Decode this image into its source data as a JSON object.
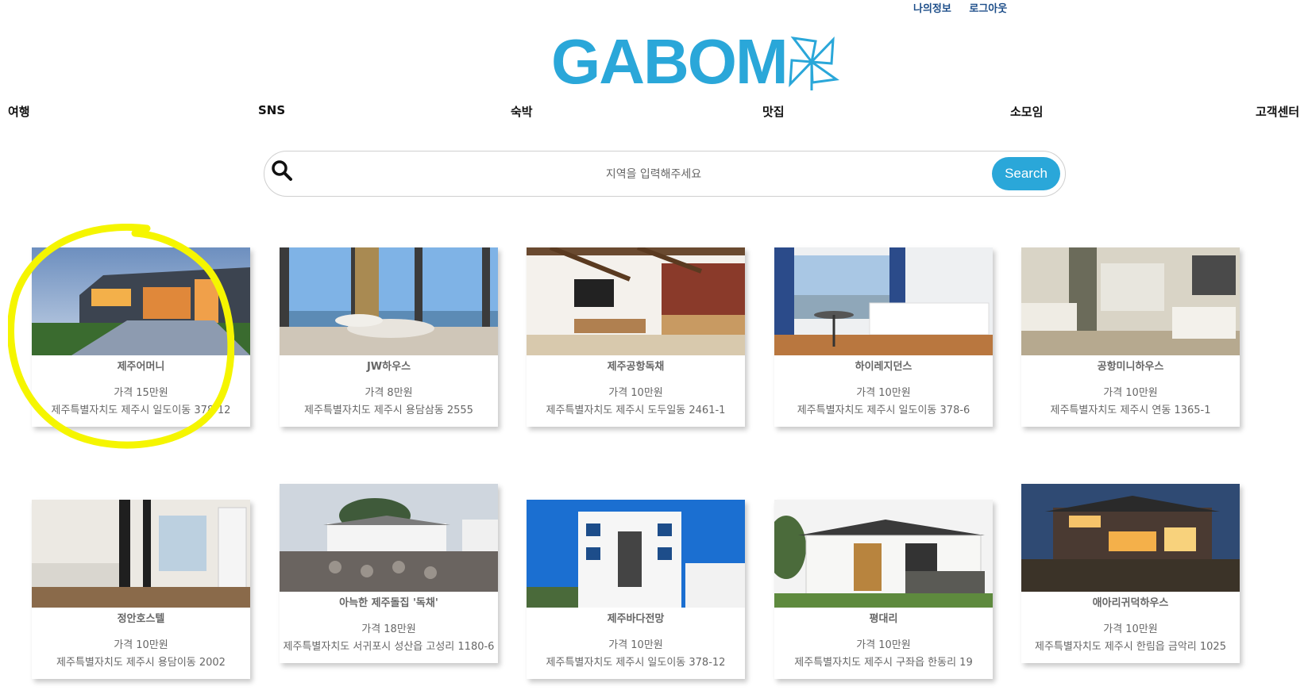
{
  "top_menu": {
    "my_info": "나의정보",
    "logout": "로그아웃"
  },
  "logo": {
    "text": "GABOM",
    "icon": "pinwheel-icon",
    "color": "#2aa7d9"
  },
  "nav": {
    "items": [
      "여행",
      "SNS",
      "숙박",
      "맛집",
      "소모임",
      "고객센터"
    ]
  },
  "search": {
    "placeholder": "지역을 입력해주세요",
    "button": "Search",
    "icon": "search-icon"
  },
  "listings": [
    {
      "name": "제주어머니",
      "price": "가격 15만원",
      "address": "제주특별자치도 제주시 일도이동 378-12",
      "highlighted": true
    },
    {
      "name": "JW하우스",
      "price": "가격 8만원",
      "address": "제주특별자치도 제주시 용담삼동 2555"
    },
    {
      "name": "제주공항독채",
      "price": "가격 10만원",
      "address": "제주특별자치도 제주시 도두일동 2461-1"
    },
    {
      "name": "하이레지던스",
      "price": "가격 10만원",
      "address": "제주특별자치도 제주시 일도이동 378-6"
    },
    {
      "name": "공항미니하우스",
      "price": "가격 10만원",
      "address": "제주특별자치도 제주시 연동 1365-1"
    },
    {
      "name": "정안호스텔",
      "price": "가격 10만원",
      "address": "제주특별자치도 제주시 용담이동 2002"
    },
    {
      "name": "아늑한 제주돌집 '독채'",
      "price": "가격 18만원",
      "address": "제주특별자치도 서귀포시 성산읍 고성리 1180-6"
    },
    {
      "name": "제주바다전망",
      "price": "가격 10만원",
      "address": "제주특별자치도 제주시 일도이동 378-12"
    },
    {
      "name": "평대리",
      "price": "가격 10만원",
      "address": "제주특별자치도 제주시 구좌읍 한동리 19"
    },
    {
      "name": "애아리귀덕하우스",
      "price": "가격 10만원",
      "address": "제주특별자치도 제주시 한림읍 금악리 1025"
    }
  ],
  "colors": {
    "accent": "#2aa7d9",
    "highlight": "#f5f500"
  }
}
